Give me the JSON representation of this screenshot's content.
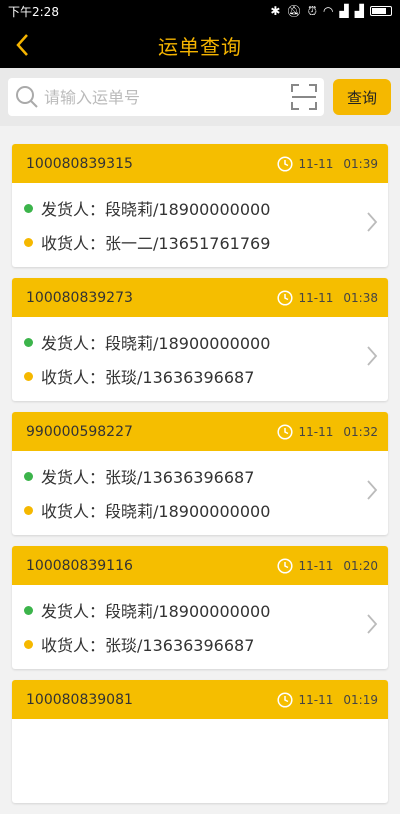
{
  "statusbar": {
    "time": "下午2:28"
  },
  "appbar": {
    "title": "运单查询"
  },
  "search": {
    "placeholder": "请输入运单号",
    "button_label": "查询"
  },
  "colors": {
    "accent": "#f5be00",
    "sender_dot": "#3cb44b",
    "receiver_dot": "#f5b800"
  },
  "labels": {
    "sender": "发货人：",
    "receiver": "收货人："
  },
  "waybills": [
    {
      "number": "100080839315",
      "date": "11-11",
      "time": "01:39",
      "sender": "段晓莉/18900000000",
      "receiver": "张一二/13651761769"
    },
    {
      "number": "100080839273",
      "date": "11-11",
      "time": "01:38",
      "sender": "段晓莉/18900000000",
      "receiver": "张琰/13636396687"
    },
    {
      "number": "990000598227",
      "date": "11-11",
      "time": "01:32",
      "sender": "张琰/13636396687",
      "receiver": "段晓莉/18900000000"
    },
    {
      "number": "100080839116",
      "date": "11-11",
      "time": "01:20",
      "sender": "段晓莉/18900000000",
      "receiver": "张琰/13636396687"
    },
    {
      "number": "100080839081",
      "date": "11-11",
      "time": "01:19",
      "sender": "",
      "receiver": ""
    }
  ]
}
